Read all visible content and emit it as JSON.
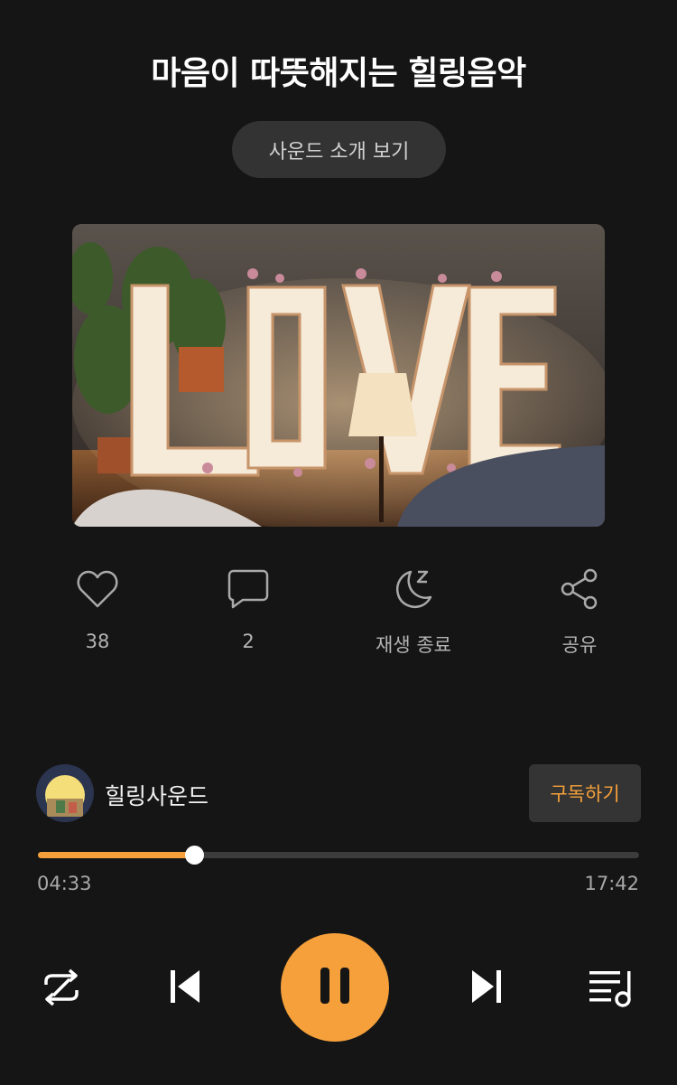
{
  "header": {
    "title": "마음이 따뜻해지는 힐링음악",
    "intro_button": "사운드 소개 보기"
  },
  "cover": {
    "text": "LOVE",
    "icon": "cover-image"
  },
  "actions": [
    {
      "icon": "heart-icon",
      "label": "38"
    },
    {
      "icon": "comment-icon",
      "label": "2"
    },
    {
      "icon": "sleep-timer-icon",
      "label": "재생 종료"
    },
    {
      "icon": "share-icon",
      "label": "공유"
    }
  ],
  "channel": {
    "name": "힐링사운드",
    "subscribe_label": "구독하기"
  },
  "player": {
    "current_time": "04:33",
    "total_time": "17:42",
    "progress": 0.26
  },
  "controls": {
    "repeat": "repeat-shuffle-icon",
    "prev": "previous-icon",
    "play_state": "pause-icon",
    "next": "next-icon",
    "playlist": "playlist-icon"
  },
  "colors": {
    "accent": "#f5a03a",
    "background": "#151515",
    "button_bg": "#333333"
  }
}
